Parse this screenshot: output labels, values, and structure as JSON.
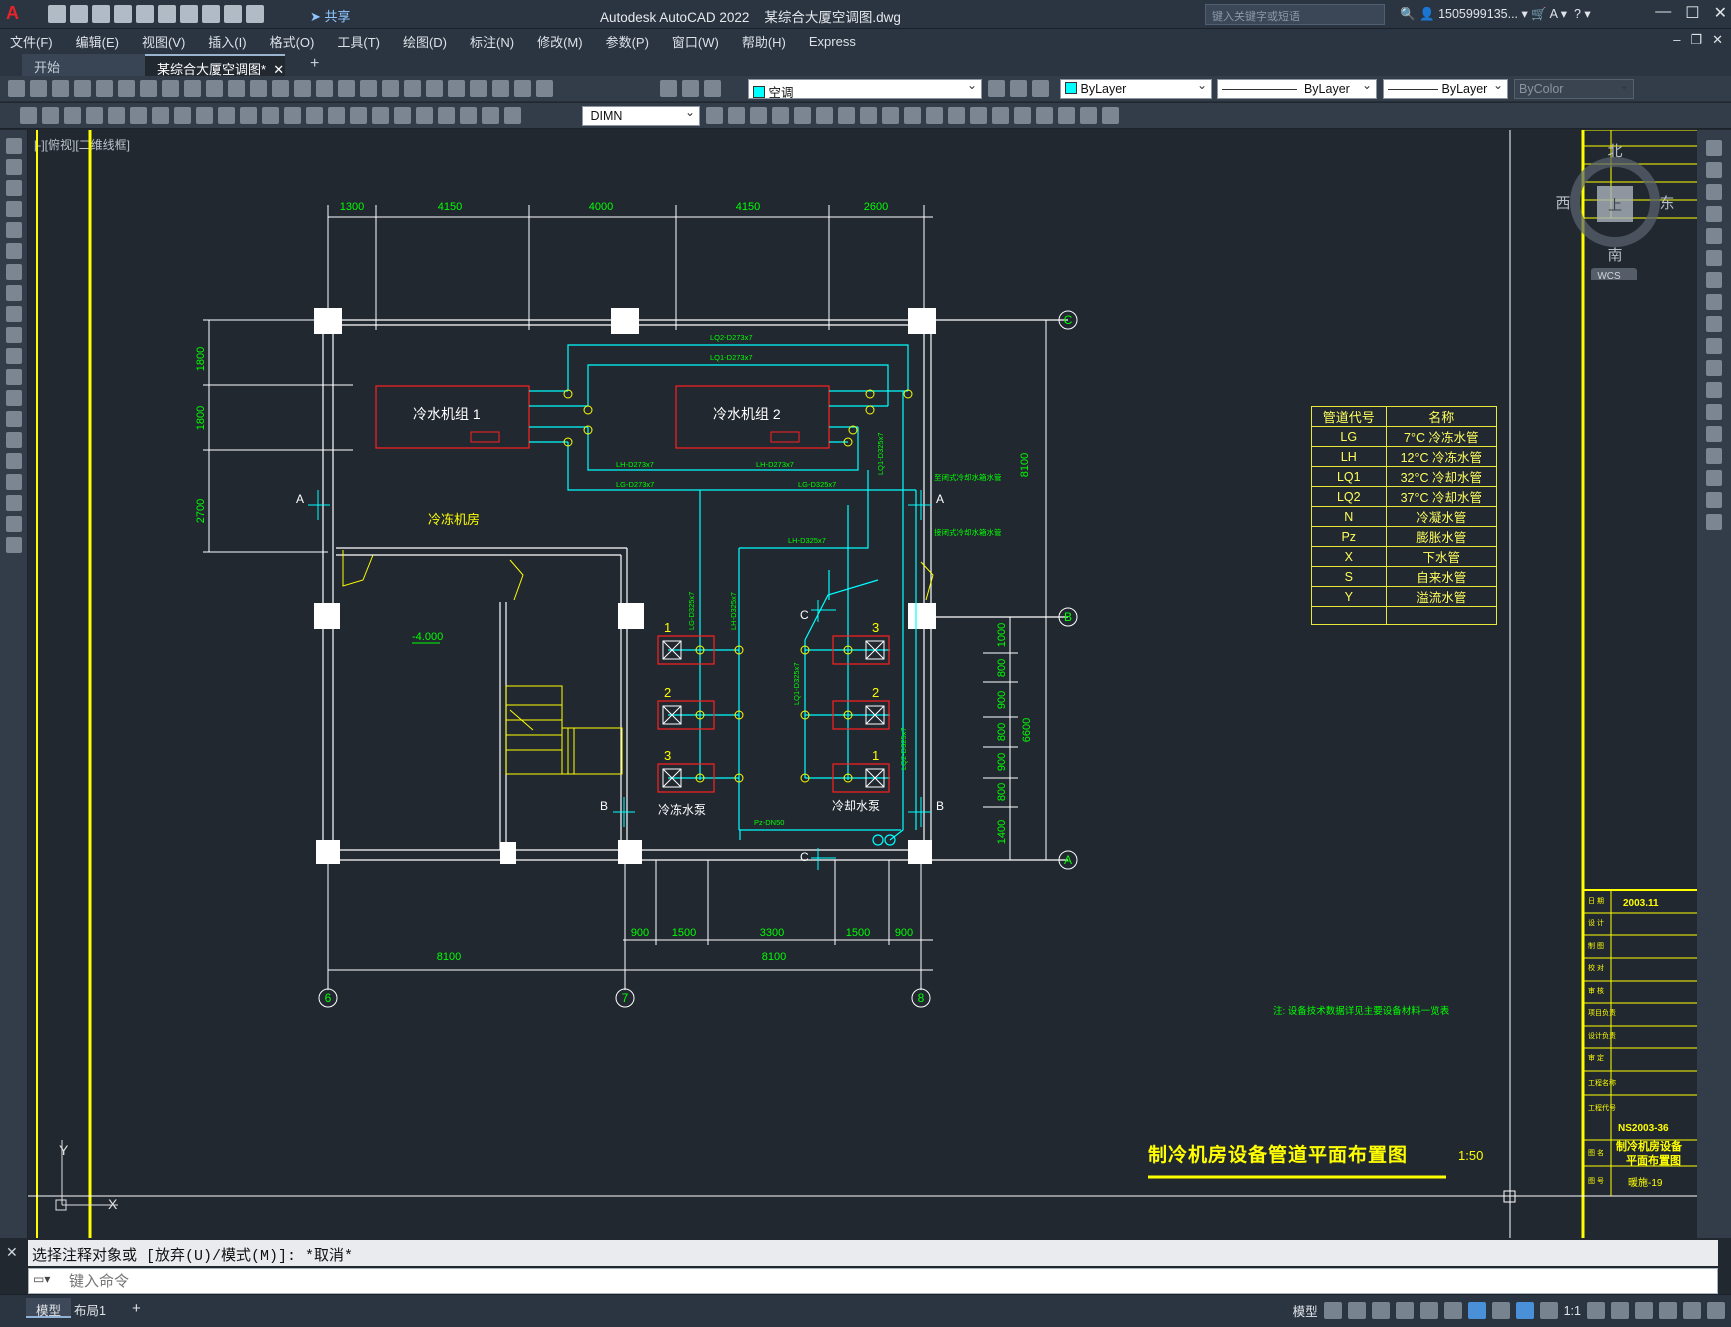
{
  "app": {
    "name": "Autodesk AutoCAD 2022",
    "file": "某综合大厦空调图.dwg",
    "share": "共享",
    "search_placeholder": "键入关键字或短语",
    "user": "1505999135...",
    "logo": "A"
  },
  "menu": [
    "文件(F)",
    "编辑(E)",
    "视图(V)",
    "插入(I)",
    "格式(O)",
    "工具(T)",
    "绘图(D)",
    "标注(N)",
    "修改(M)",
    "参数(P)",
    "窗口(W)",
    "帮助(H)",
    "Express"
  ],
  "tabs": {
    "start": "开始",
    "doc": "某综合大厦空调图*",
    "close": "✕",
    "add": "+"
  },
  "toolbar": {
    "layer": "空调",
    "color": "ByLayer",
    "linetype": "ByLayer",
    "lineweight": "ByLayer",
    "plotstyle": "ByColor",
    "dimstyle": "DIMN"
  },
  "viewport": {
    "label": "[-][俯视][二维线框]"
  },
  "viewcube": {
    "north": "北",
    "south": "南",
    "east": "东",
    "west": "西",
    "top": "上",
    "wcs": "WCS"
  },
  "drawing": {
    "dims_top": [
      "1300",
      "4150",
      "4000",
      "4150",
      "2600"
    ],
    "dims_left": [
      "1800",
      "1800",
      "2700"
    ],
    "dims_right": [
      "8100",
      "1000",
      "800",
      "900",
      "800",
      "900",
      "800",
      "1400",
      "6600"
    ],
    "dims_bottom_inner": [
      "900",
      "1500",
      "3300",
      "1500",
      "900"
    ],
    "dims_bottom": [
      "8100",
      "8100"
    ],
    "axes_bottom": [
      "6",
      "7",
      "8"
    ],
    "axes_right": [
      "C",
      "B",
      "A"
    ],
    "chiller1": "冷水机组   1",
    "chiller2": "冷水机组   2",
    "room": "冷冻机房",
    "level": "-4.000",
    "chw_pumps": "冷冻水泵",
    "cw_pumps": "冷却水泵",
    "pipe_labels": [
      "LQ2-D273x7",
      "LQ1-D273x7",
      "LH-D273x7",
      "LH-D273x7",
      "LG-D273x7",
      "LG-D325x7",
      "LH-D325x7",
      "LQ1-D325x7",
      "LG-D325x7",
      "LH-D325x7",
      "LQ1-D325x7",
      "LQ2-D325x7",
      "Pz-DN50"
    ],
    "pipe_side_notes": [
      "至闭式冷却水箱水管",
      "接闭式冷却水箱水管"
    ],
    "section_marks": [
      "A",
      "A",
      "B",
      "B",
      "C",
      "C"
    ],
    "pump_nums": [
      "1",
      "2",
      "3",
      "3",
      "2",
      "1"
    ]
  },
  "legend": {
    "headers": [
      "管道代号",
      "名称"
    ],
    "rows": [
      [
        "LG",
        "7°C 冷冻水管"
      ],
      [
        "LH",
        "12°C 冷冻水管"
      ],
      [
        "LQ1",
        "32°C 冷却水管"
      ],
      [
        "LQ2",
        "37°C 冷却水管"
      ],
      [
        "N",
        "冷凝水管"
      ],
      [
        "Pz",
        "膨胀水管"
      ],
      [
        "X",
        "下水管"
      ],
      [
        "S",
        "自来水管"
      ],
      [
        "Y",
        "溢流水管"
      ],
      [
        "",
        ""
      ]
    ]
  },
  "title": {
    "name": "制冷机房设备管道平面布置图",
    "scale": "1:50",
    "note": "注: 设备技术数据详见主要设备材料一览表"
  },
  "titleblock": {
    "date": "2003.11",
    "project_no": "NS2003-36",
    "drawing_title1": "制冷机房设备",
    "drawing_title2": "平面布置图",
    "drawing_no": "暖施-19"
  },
  "command": {
    "history": "选择注释对象或 [放弃(U)/模式(M)]: *取消*",
    "placeholder": "键入命令"
  },
  "status": {
    "model": "模型",
    "layout": "布局1",
    "add": "+",
    "model_btn": "模型",
    "scale": "1:1"
  },
  "colors": {
    "cyan": "#00ffff",
    "green": "#00ff00",
    "yellow": "#ffff00",
    "red": "#ff2020",
    "white": "#ffffff"
  }
}
